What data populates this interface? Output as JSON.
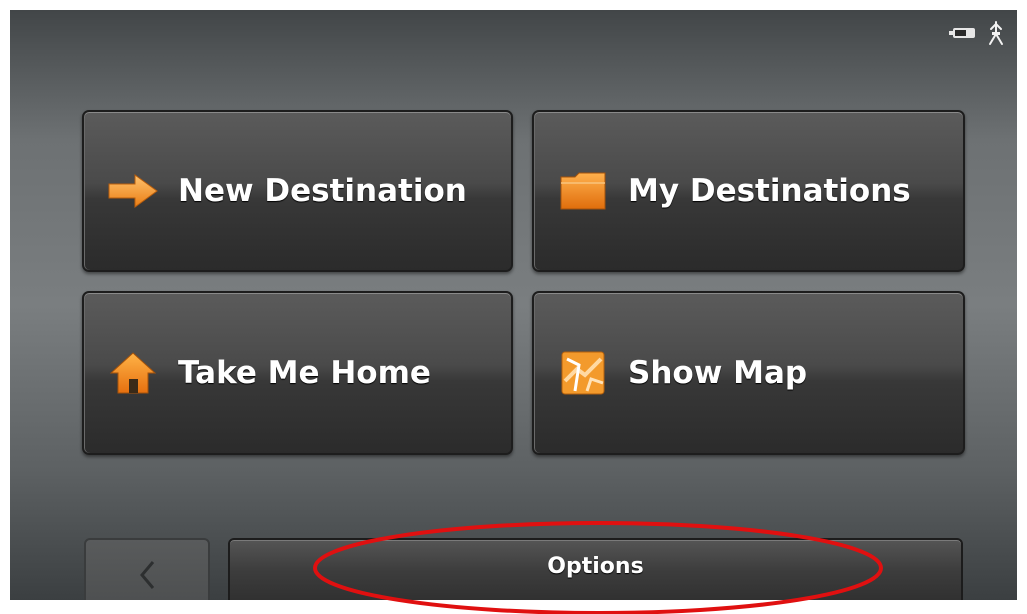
{
  "menu": {
    "new_destination": "New Destination",
    "my_destinations": "My Destinations",
    "take_me_home": "Take Me Home",
    "show_map": "Show Map"
  },
  "footer": {
    "options_label": "Options"
  },
  "icons": {
    "new_destination": "arrow-right-icon",
    "my_destinations": "folder-icon",
    "take_me_home": "home-icon",
    "show_map": "map-icon",
    "back": "chevron-left-icon",
    "battery": "battery-icon",
    "gps": "gps-satellite-icon"
  },
  "colors": {
    "accent_orange": "#f7941d",
    "annotation_red": "#e01010"
  }
}
